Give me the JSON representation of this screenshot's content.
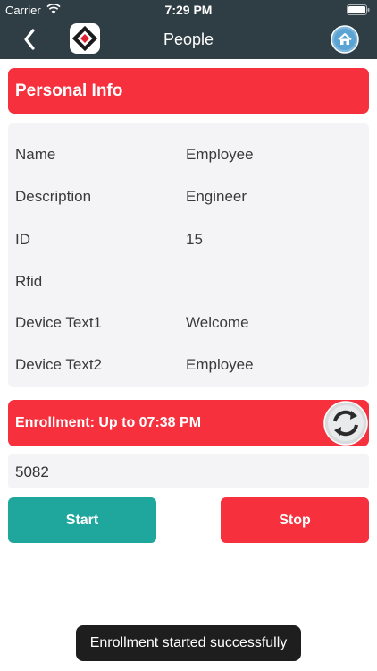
{
  "status_bar": {
    "carrier": "Carrier",
    "time": "7:29 PM"
  },
  "nav": {
    "title": "People",
    "icons": {
      "back": "chevron-left-icon",
      "logo": "app-logo-icon",
      "home": "home-icon"
    }
  },
  "personal_info": {
    "header": "Personal Info",
    "rows": [
      {
        "label": "Name",
        "value": "Employee"
      },
      {
        "label": "Description",
        "value": "Engineer"
      },
      {
        "label": "ID",
        "value": "15"
      },
      {
        "label": "Rfid",
        "value": ""
      },
      {
        "label": "Device Text1",
        "value": "Welcome"
      },
      {
        "label": "Device Text2",
        "value": "Employee"
      }
    ]
  },
  "enrollment": {
    "header": "Enrollment: Up to 07:38 PM",
    "code": "5082"
  },
  "actions": {
    "start_label": "Start",
    "stop_label": "Stop"
  },
  "toast": {
    "message": "Enrollment started successfully"
  },
  "colors": {
    "nav_bg": "#2f3d45",
    "accent_red": "#f6303d",
    "start_teal": "#1fa79e",
    "card_bg": "#f4f4f6"
  }
}
